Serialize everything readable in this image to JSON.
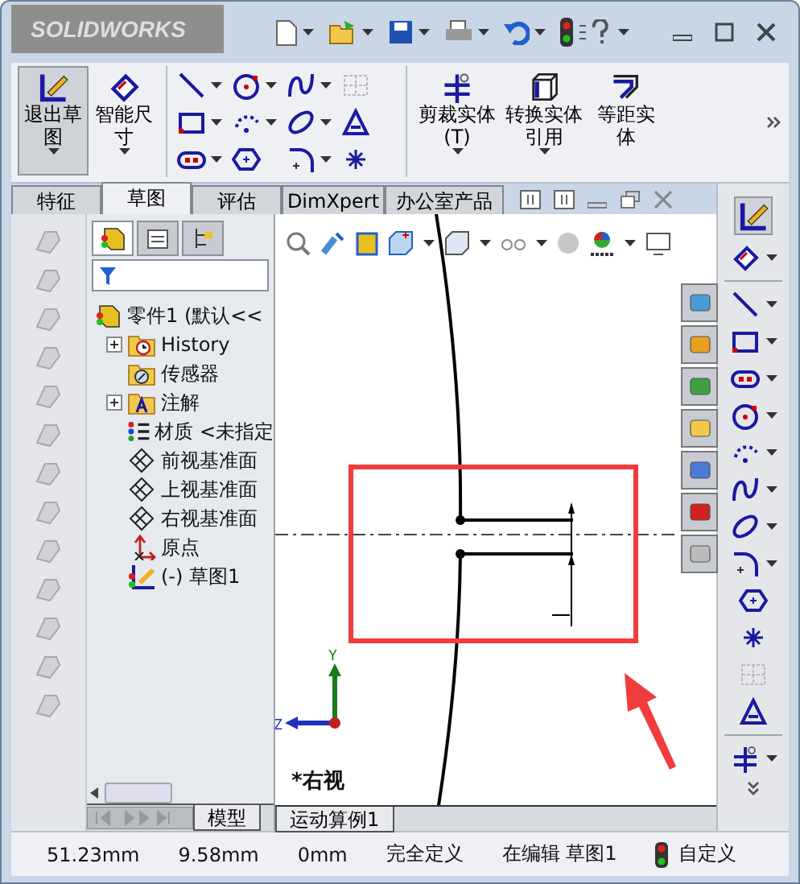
{
  "title_bar": {
    "logo": "SOLIDWORKS"
  },
  "ribbon": {
    "commands": [
      {
        "label": "退出草图",
        "kind": "sketch",
        "selected": true
      },
      {
        "label": "智能尺寸",
        "kind": "dimension",
        "selected": false
      },
      {
        "label": "剪裁实体(T)",
        "kind": "trim",
        "selected": false
      },
      {
        "label": "转换实体引用",
        "kind": "convert",
        "selected": false
      },
      {
        "label": "等距实体",
        "kind": "offset",
        "selected": false
      }
    ]
  },
  "tabs": [
    {
      "label": "特征",
      "selected": false
    },
    {
      "label": "草图",
      "selected": true
    },
    {
      "label": "评估",
      "selected": false
    },
    {
      "label": "DimXpert",
      "selected": false
    },
    {
      "label": "办公室产品",
      "selected": false
    }
  ],
  "feature_tree": {
    "root": {
      "label": "零件1  (默认<<",
      "kind": "part",
      "children": [
        {
          "label": "History",
          "kind": "history",
          "expanded": false
        },
        {
          "label": "传感器",
          "kind": "sensor"
        },
        {
          "label": "注解",
          "kind": "annotation",
          "expanded": false
        },
        {
          "label": "材质 <未指定",
          "kind": "material"
        },
        {
          "label": "前视基准面",
          "kind": "plane"
        },
        {
          "label": "上视基准面",
          "kind": "plane"
        },
        {
          "label": "右视基准面",
          "kind": "plane"
        },
        {
          "label": "原点",
          "kind": "origin"
        },
        {
          "label": "(-) 草图1",
          "kind": "sketch"
        }
      ]
    }
  },
  "graphics": {
    "view_label": "*右视",
    "axis_y": "Y",
    "axis_z": "Z"
  },
  "bottom_tabs": {
    "model": "模型",
    "motion": "运动算例1"
  },
  "status_bar": [
    {
      "text": "51.23mm"
    },
    {
      "text": "9.58mm"
    },
    {
      "text": "0mm"
    },
    {
      "text": "完全定义"
    },
    {
      "text": "在编辑 草图1"
    },
    {
      "text": "自定义"
    }
  ]
}
